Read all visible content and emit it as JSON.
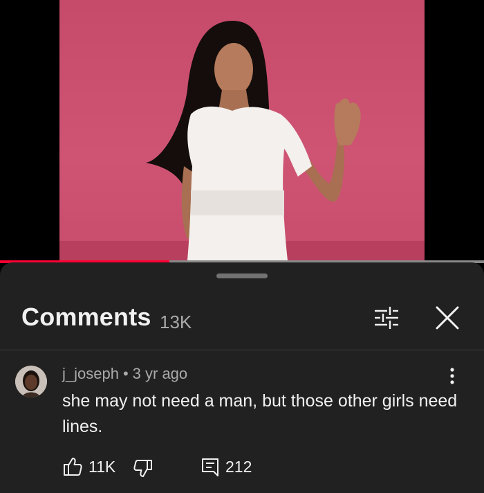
{
  "video": {
    "background_color": "#000000",
    "frame_color": "#c64a6a",
    "progress_fraction": 0.35,
    "progress_color": "#ff0033"
  },
  "comments_panel": {
    "title": "Comments",
    "count": "13K",
    "filter_icon": "sliders-icon",
    "close_icon": "close-icon"
  },
  "comment": {
    "author": "j_joseph",
    "separator": "•",
    "time": "3 yr ago",
    "text": "she may not need a man, but those other girls need lines.",
    "likes": "11K",
    "replies": "212",
    "icons": [
      "thumbs-up-icon",
      "thumbs-down-icon",
      "reply-icon",
      "more-vert-icon"
    ]
  }
}
